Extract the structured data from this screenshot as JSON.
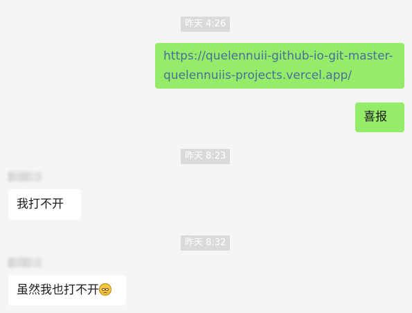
{
  "chat": {
    "timestamps": [
      "昨天 4:26",
      "昨天 8:23",
      "昨天 8:32"
    ],
    "messages": [
      {
        "direction": "out",
        "lines": [
          "https://quelennuii-github-io-git-master-",
          "quelennuiis-projects.vercel.app/"
        ]
      },
      {
        "direction": "out",
        "text": "喜报"
      },
      {
        "direction": "in",
        "text": "我打不开"
      },
      {
        "direction": "in",
        "text": "虽然我也打不开",
        "emoji": "pleading-face-icon"
      }
    ]
  },
  "colors": {
    "outgoing_bubble": "#95ec69",
    "incoming_bubble": "#ffffff",
    "link": "#4a6e9b",
    "background": "#f5f5f5",
    "timestamp_bg": "#dadada"
  }
}
